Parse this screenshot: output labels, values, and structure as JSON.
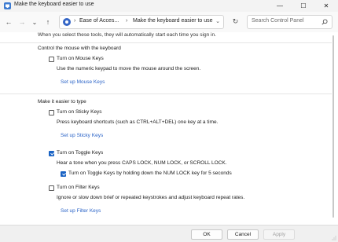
{
  "window": {
    "title": "Make the keyboard easier to use",
    "minimize_glyph": "—",
    "maximize_glyph": "☐",
    "close_glyph": "✕",
    "app_icon": "control-panel-icon"
  },
  "nav": {
    "back_glyph": "←",
    "forward_glyph": "→",
    "recent_glyph": "⌄",
    "up_glyph": "↑",
    "refresh_glyph": "↻"
  },
  "address": {
    "sep_glyph": "›",
    "crumbs": [
      "Ease of Acces...",
      "Make the keyboard easier to use"
    ],
    "dropdown_glyph": "⌄"
  },
  "search": {
    "placeholder": "Search Control Panel"
  },
  "content": {
    "intro_text": "When you select these tools, they will automatically start each time you sign in.",
    "mouse_section": {
      "heading": "Control the mouse with the keyboard",
      "mouse_keys": {
        "label": "Turn on Mouse Keys",
        "checked": false,
        "description": "Use the numeric keypad to move the mouse around the screen.",
        "setup_link": "Set up Mouse Keys"
      }
    },
    "typing_section": {
      "heading": "Make it easier to type",
      "sticky_keys": {
        "label": "Turn on Sticky Keys",
        "checked": false,
        "description": "Press keyboard shortcuts (such as CTRL+ALT+DEL) one key at a time.",
        "setup_link": "Set up Sticky Keys"
      },
      "toggle_keys": {
        "label": "Turn on Toggle Keys",
        "checked": true,
        "description": "Hear a tone when you press CAPS LOCK, NUM LOCK, or SCROLL LOCK.",
        "sub_option": {
          "label": "Turn on Toggle Keys by holding down the NUM LOCK key for 5 seconds",
          "checked": true
        }
      },
      "filter_keys": {
        "label": "Turn on Filter Keys",
        "checked": false,
        "description": "Ignore or slow down brief or repeated keystrokes and adjust keyboard repeat rates.",
        "setup_link": "Set up Filter Keys"
      }
    }
  },
  "footer": {
    "ok_label": "OK",
    "cancel_label": "Cancel",
    "apply_label": "Apply",
    "apply_enabled": false
  },
  "colors": {
    "accent": "#1a63c4",
    "link": "#2a63c7"
  }
}
